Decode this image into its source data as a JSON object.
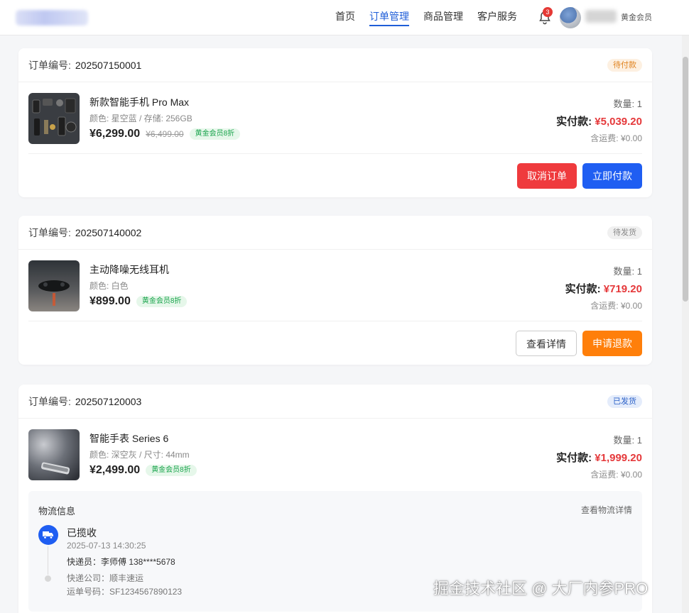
{
  "header": {
    "nav": [
      {
        "label": "首页",
        "active": false
      },
      {
        "label": "订单管理",
        "active": true
      },
      {
        "label": "商品管理",
        "active": false
      },
      {
        "label": "客户服务",
        "active": false
      }
    ],
    "notification_count": "3",
    "member_level": "黄金会员"
  },
  "labels": {
    "order_no": "订单编号:",
    "qty_prefix": "数量:",
    "paid_prefix": "实付款:",
    "shipping": "含运费: ¥0.00",
    "member_tag": "黄金会员8折"
  },
  "orders": [
    {
      "order_no": "202507150001",
      "status": "待付款",
      "name": "新款智能手机 Pro Max",
      "spec": "颜色: 星空蓝 / 存储: 256GB",
      "price": "¥6,299.00",
      "orig_price": "¥6,499.00",
      "qty": "1",
      "paid": "¥5,039.20",
      "buttons": [
        "取消订单",
        "立即付款"
      ]
    },
    {
      "order_no": "202507140002",
      "status": "待发货",
      "name": "主动降噪无线耳机",
      "spec": "颜色: 白色",
      "price": "¥899.00",
      "qty": "1",
      "paid": "¥719.20",
      "buttons": [
        "查看详情",
        "申请退款"
      ]
    },
    {
      "order_no": "202507120003",
      "status": "已发货",
      "name": "智能手表 Series 6",
      "spec": "颜色: 深空灰 / 尺寸: 44mm",
      "price": "¥2,499.00",
      "qty": "1",
      "paid": "¥1,999.20"
    }
  ],
  "logistics": {
    "title": "物流信息",
    "detail_link": "查看物流详情",
    "status": "已揽收",
    "time": "2025-07-13 14:30:25",
    "courier": "快递员：李师傅 138****5678",
    "company": "快递公司：顺丰速运",
    "tracking": "运单号码：SF1234567890123"
  },
  "watermark": "掘金技术社区 @ 大厂内参PRO",
  "colors": {
    "accent": "#1f5ef2",
    "price_red": "#e5393b",
    "cancel_red": "#ef3a3d",
    "refund_orange": "#ff7f0a"
  }
}
